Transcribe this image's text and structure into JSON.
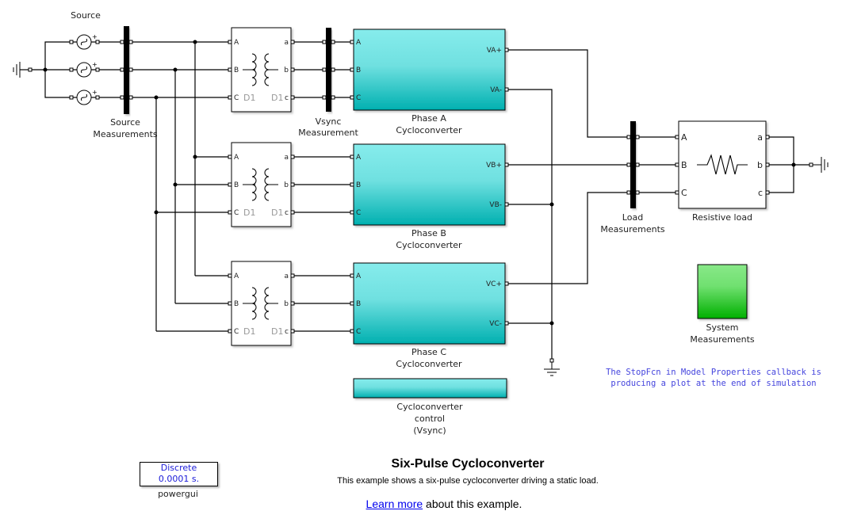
{
  "diagram": {
    "title": "Six-Pulse Cycloconverter",
    "description": "This example shows a six-pulse cycloconverter driving a static load.",
    "learn_more_link": "Learn more",
    "learn_more_suffix": " about this example.",
    "note_line1": "The StopFcn in Model Properties callback is",
    "note_line2": "producing a plot at the end of simulation"
  },
  "blocks": {
    "source": {
      "label": "Source"
    },
    "source_meas": {
      "label1": "Source",
      "label2": "Measurements"
    },
    "vsync_meas": {
      "label1": "Vsync",
      "label2": "Measurement"
    },
    "transformer": {
      "ports_in": [
        "A",
        "B",
        "C"
      ],
      "ports_out": [
        "a",
        "b",
        "c"
      ],
      "winding_left": "D1",
      "winding_right": "D1"
    },
    "cyclo_a": {
      "label1": "Phase A",
      "label2": "Cycloconverter",
      "plus": "VA+",
      "minus": "VA-"
    },
    "cyclo_b": {
      "label1": "Phase B",
      "label2": "Cycloconverter",
      "plus": "VB+",
      "minus": "VB-"
    },
    "cyclo_c": {
      "label1": "Phase C",
      "label2": "Cycloconverter",
      "plus": "VC+",
      "minus": "VC-"
    },
    "cyclo_ports": [
      "A",
      "B",
      "C"
    ],
    "control": {
      "label1": "Cycloconverter",
      "label2": "control",
      "label3": "(Vsync)"
    },
    "load_meas": {
      "label1": "Load",
      "label2": "Measurements"
    },
    "resistive_load": {
      "label": "Resistive load",
      "ports_in": [
        "A",
        "B",
        "C"
      ],
      "ports_out": [
        "a",
        "b",
        "c"
      ]
    },
    "system_meas": {
      "label1": "System",
      "label2": "Measurements"
    },
    "powergui": {
      "line1": "Discrete",
      "line2": "0.0001 s.",
      "label": "powergui"
    }
  },
  "colors": {
    "cyclo_top": "#86ecec",
    "cyclo_bottom": "#00b0b0",
    "scope_top": "#88e888",
    "scope_bottom": "#00b000",
    "note": "#4444dd",
    "powergui_text": "#1a1ad8",
    "link": "#0000ee"
  }
}
